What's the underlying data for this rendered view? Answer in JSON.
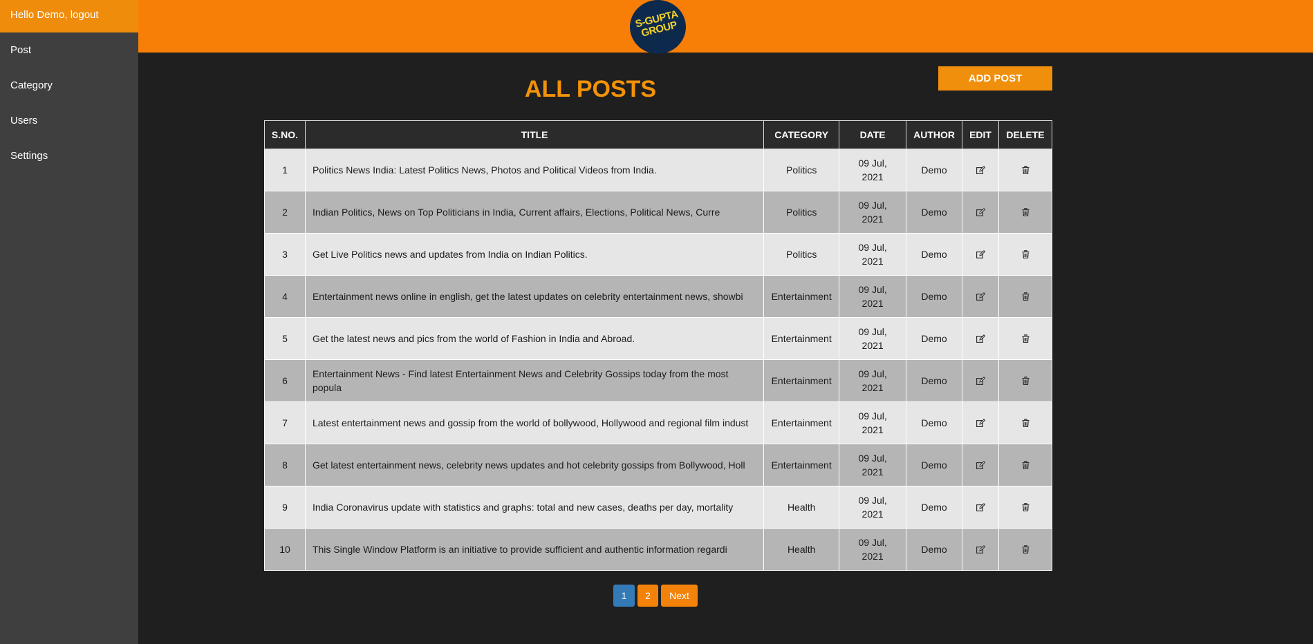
{
  "sidebar": {
    "greeting": "Hello Demo, logout",
    "items": [
      {
        "label": "Post"
      },
      {
        "label": "Category"
      },
      {
        "label": "Users"
      },
      {
        "label": "Settings"
      }
    ]
  },
  "header": {
    "logo_line1": "S-GUPTA",
    "logo_line2": "GROUP"
  },
  "main": {
    "title": "ALL POSTS",
    "add_button": "ADD POST",
    "columns": [
      "S.NO.",
      "TITLE",
      "CATEGORY",
      "DATE",
      "AUTHOR",
      "EDIT",
      "DELETE"
    ],
    "rows": [
      {
        "sno": "1",
        "title": "Politics News India: Latest Politics News, Photos and Political Videos from India.",
        "category": "Politics",
        "date_line1": "09 Jul,",
        "date_line2": "2021",
        "author": "Demo"
      },
      {
        "sno": "2",
        "title": "Indian Politics, News on Top Politicians in India, Current affairs, Elections, Political News, Curre",
        "category": "Politics",
        "date_line1": "09 Jul,",
        "date_line2": "2021",
        "author": "Demo"
      },
      {
        "sno": "3",
        "title": "Get Live Politics news and updates from India on Indian Politics.",
        "category": "Politics",
        "date_line1": "09 Jul,",
        "date_line2": "2021",
        "author": "Demo"
      },
      {
        "sno": "4",
        "title": "Entertainment news online in english, get the latest updates on celebrity entertainment news, showbi",
        "category": "Entertainment",
        "date_line1": "09 Jul,",
        "date_line2": "2021",
        "author": "Demo"
      },
      {
        "sno": "5",
        "title": "Get the latest news and pics from the world of Fashion in India and Abroad.",
        "category": "Entertainment",
        "date_line1": "09 Jul,",
        "date_line2": "2021",
        "author": "Demo"
      },
      {
        "sno": "6",
        "title": "Entertainment News - Find latest Entertainment News and Celebrity Gossips today from the most popula",
        "category": "Entertainment",
        "date_line1": "09 Jul,",
        "date_line2": "2021",
        "author": "Demo"
      },
      {
        "sno": "7",
        "title": "Latest entertainment news and gossip from the world of bollywood, Hollywood and regional film indust",
        "category": "Entertainment",
        "date_line1": "09 Jul,",
        "date_line2": "2021",
        "author": "Demo"
      },
      {
        "sno": "8",
        "title": "Get latest entertainment news, celebrity news updates and hot celebrity gossips from Bollywood, Holl",
        "category": "Entertainment",
        "date_line1": "09 Jul,",
        "date_line2": "2021",
        "author": "Demo"
      },
      {
        "sno": "9",
        "title": "India Coronavirus update with statistics and graphs: total and new cases, deaths per day, mortality",
        "category": "Health",
        "date_line1": "09 Jul,",
        "date_line2": "2021",
        "author": "Demo"
      },
      {
        "sno": "10",
        "title": "This Single Window Platform is an initiative to provide sufficient and authentic information regardi",
        "category": "Health",
        "date_line1": "09 Jul,",
        "date_line2": "2021",
        "author": "Demo"
      }
    ]
  },
  "pagination": {
    "page1": "1",
    "page2": "2",
    "next": "Next"
  },
  "colors": {
    "accent": "#f77f08",
    "active_page": "#347ab6",
    "sidebar_bg": "#3f3f3f",
    "main_bg": "#1f1f1f"
  },
  "icons": {
    "edit": "edit-icon",
    "delete": "trash-icon"
  }
}
